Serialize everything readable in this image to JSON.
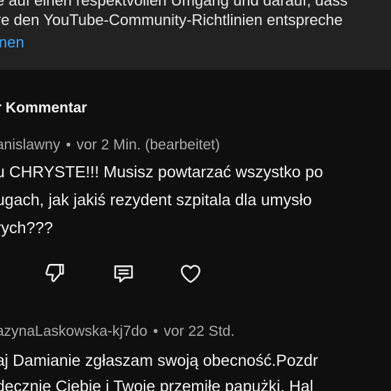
{
  "banner": {
    "line1": "e auf einen respektvollen Umgang und darauf, dass",
    "line2": "re den YouTube-Community-Richtlinien entspreche",
    "link": "nen"
  },
  "section": {
    "title": "r Kommentar"
  },
  "comments": [
    {
      "author": "anislawny",
      "separator": "•",
      "time": "vor 2 Min. (bearbeitet)",
      "lines": [
        "u CHRYSTE!!! Musisz powtarzać wszystko po",
        "ugach, jak jakiś rezydent szpitala dla umysło",
        "rych???"
      ]
    },
    {
      "author": "azynaLaskowska-kj7do",
      "separator": "•",
      "time": "vor 22 Std.",
      "lines": [
        "aj Damianie zgłaszam swoją obecność.Pozdr",
        "decznie Ciebie i Twoje przemiłe papużki. Hal"
      ]
    }
  ],
  "actions": {
    "icons": [
      "dislike-icon",
      "reply-icon",
      "heart-icon"
    ]
  }
}
